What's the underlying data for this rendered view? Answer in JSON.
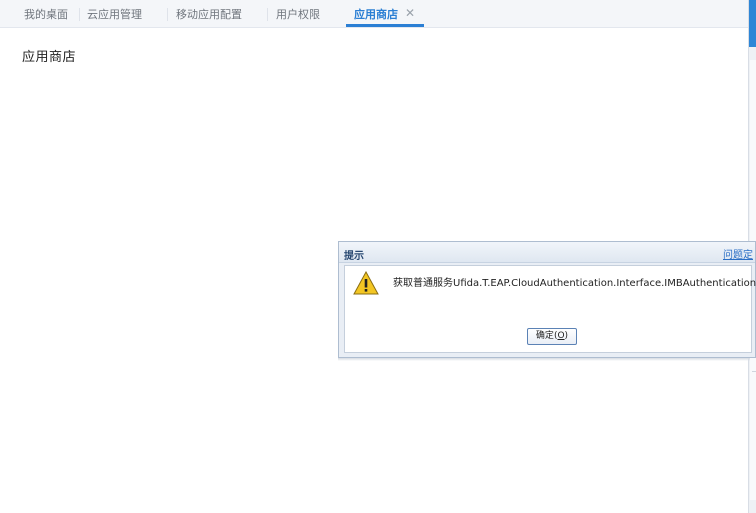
{
  "tabs": [
    {
      "label": "我的桌面"
    },
    {
      "label": "云应用管理"
    },
    {
      "label": "移动应用配置"
    },
    {
      "label": "用户权限"
    },
    {
      "label": "应用商店",
      "close": "✕"
    }
  ],
  "page": {
    "title": "应用商店"
  },
  "dialog": {
    "title": "提示",
    "link": "问题定",
    "message": "获取普通服务Ufida.T.EAP.CloudAuthentication.Interface.IMBAuthentication出错.",
    "ok_label": "确定",
    "ok_paren_open": "(",
    "ok_key": "O",
    "ok_paren_close": ")"
  },
  "colors": {
    "accent": "#2b7fd4",
    "warning": "#f3c623"
  }
}
